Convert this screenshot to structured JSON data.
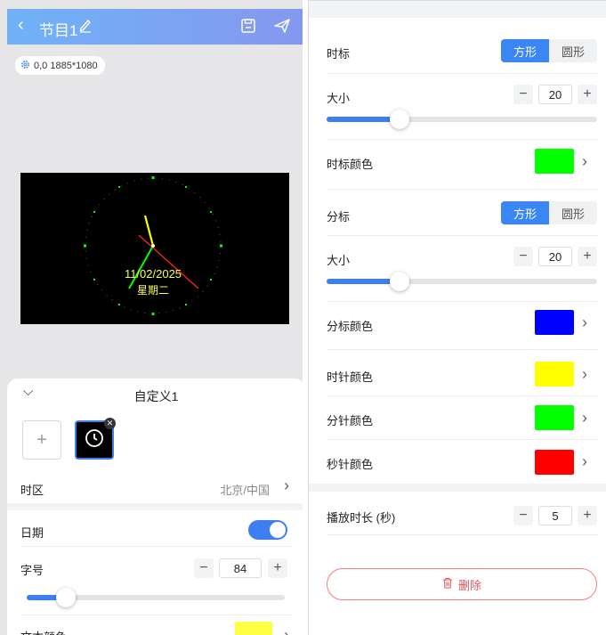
{
  "header": {
    "title": "节目1"
  },
  "canvas_info": {
    "text": "0,0 1885*1080"
  },
  "preview": {
    "date": "11/02/2025",
    "weekday": "星期二"
  },
  "sheet": {
    "title": "自定义1",
    "timezone": {
      "label": "时区",
      "value": "北京/中国"
    },
    "date_toggle": {
      "label": "日期",
      "on": true
    },
    "font_size": {
      "label": "字号",
      "value": "84",
      "level": 0.15
    },
    "text_color": {
      "label": "文本颜色",
      "color": "#ffff44"
    }
  },
  "settings": {
    "hour_mark": {
      "label": "时标",
      "options": [
        "方形",
        "圆形"
      ],
      "selected": "方形"
    },
    "hour_size": {
      "label": "大小",
      "value": "20",
      "level": 0.27
    },
    "hour_mark_color": {
      "label": "时标颜色",
      "color": "#00ff00"
    },
    "minute_mark": {
      "label": "分标",
      "options": [
        "方形",
        "圆形"
      ],
      "selected": "方形"
    },
    "minute_size": {
      "label": "大小",
      "value": "20",
      "level": 0.27
    },
    "minute_mark_color": {
      "label": "分标颜色",
      "color": "#0000ff"
    },
    "hour_hand_color": {
      "label": "时针颜色",
      "color": "#ffff00"
    },
    "minute_hand_color": {
      "label": "分针颜色",
      "color": "#00ff00"
    },
    "second_hand_color": {
      "label": "秒针颜色",
      "color": "#ff0000"
    },
    "duration": {
      "label": "播放时长 (秒)",
      "value": "5"
    },
    "delete_label": "删除"
  },
  "icons": {
    "back": "chevron-left-icon",
    "edit": "pencil-icon",
    "save": "floppy-icon",
    "send": "send-icon",
    "gear": "gear-icon",
    "collapse": "chevron-down-icon",
    "add": "plus-icon",
    "clock": "clock-icon",
    "close": "close-icon",
    "chevron": "chevron-right-icon",
    "trash": "trash-icon"
  }
}
